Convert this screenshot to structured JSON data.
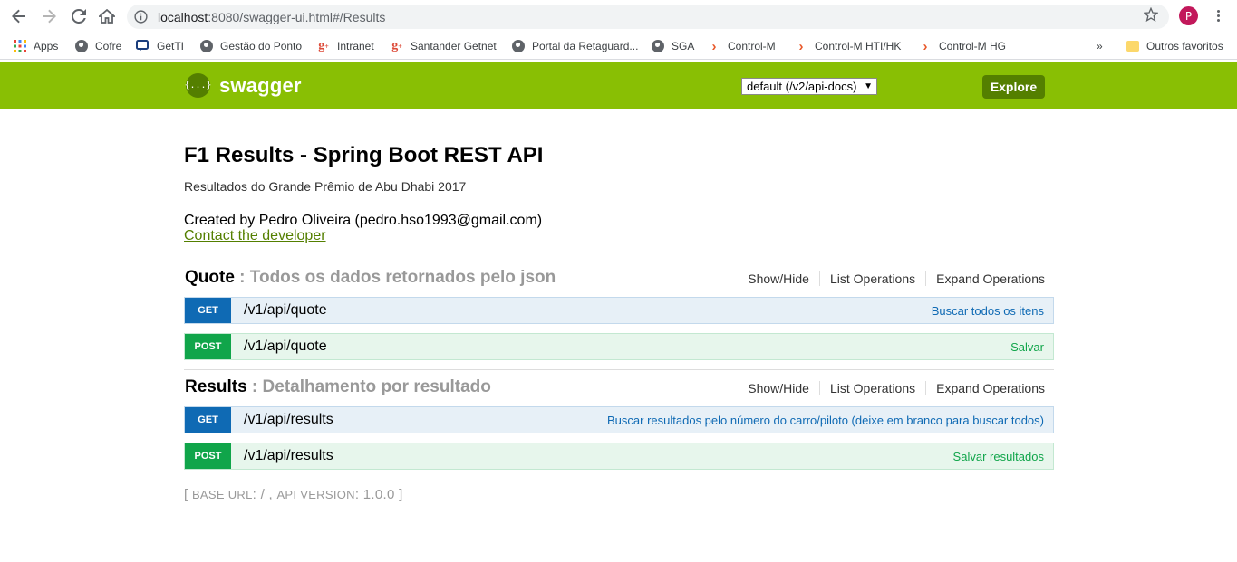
{
  "browser": {
    "url_host": "localhost",
    "url_rest": ":8080/swagger-ui.html#/Results",
    "profile_initial": "P",
    "bookmarks": [
      {
        "label": "Apps",
        "icon": "apps-grid-icon"
      },
      {
        "label": "Cofre",
        "icon": "globe-icon"
      },
      {
        "label": "GetTI",
        "icon": "chat-icon"
      },
      {
        "label": "Gestão do Ponto",
        "icon": "globe-icon"
      },
      {
        "label": "Intranet",
        "icon": "gplus-icon"
      },
      {
        "label": "Santander Getnet",
        "icon": "gplus-icon"
      },
      {
        "label": "Portal da Retaguard...",
        "icon": "globe-icon"
      },
      {
        "label": "SGA",
        "icon": "globe-icon"
      },
      {
        "label": "Control-M",
        "icon": "control-m-icon"
      },
      {
        "label": "Control-M HTI/HK",
        "icon": "control-m-icon"
      },
      {
        "label": "Control-M HG",
        "icon": "control-m-icon"
      }
    ],
    "overflow": "»",
    "other_bookmarks": "Outros favoritos"
  },
  "swagger": {
    "logo_text": "swagger",
    "logo_glyph": "{...}",
    "spec_select": "default (/v2/api-docs)",
    "explore_label": "Explore",
    "colors": {
      "header": "#89bf04",
      "dark": "#547f00",
      "get": "#0f6ab4",
      "post": "#10a54a"
    }
  },
  "info": {
    "title": "F1 Results - Spring Boot REST API",
    "description": "Resultados do Grande Prêmio de Abu Dhabi 2017",
    "created_by": "Created by Pedro Oliveira (pedro.hso1993@gmail.com)",
    "contact": "Contact the developer"
  },
  "resources": [
    {
      "name": "Quote",
      "description": ": Todos os dados retornados pelo json",
      "actions": [
        "Show/Hide",
        "List Operations",
        "Expand Operations"
      ],
      "operations": [
        {
          "method": "GET",
          "path": "/v1/api/quote",
          "summary": "Buscar todos os itens"
        },
        {
          "method": "POST",
          "path": "/v1/api/quote",
          "summary": "Salvar"
        }
      ]
    },
    {
      "name": "Results",
      "description": ": Detalhamento por resultado",
      "actions": [
        "Show/Hide",
        "List Operations",
        "Expand Operations"
      ],
      "operations": [
        {
          "method": "GET",
          "path": "/v1/api/results",
          "summary": "Buscar resultados pelo número do carro/piloto (deixe em branco para buscar todos)"
        },
        {
          "method": "POST",
          "path": "/v1/api/results",
          "summary": "Salvar resultados"
        }
      ]
    }
  ],
  "footer": {
    "open": "[ ",
    "base_url_label": "BASE URL",
    "base_url_value": ": / , ",
    "api_version_label": "API VERSION",
    "api_version_value": ": 1.0.0 ",
    "close": "]"
  }
}
